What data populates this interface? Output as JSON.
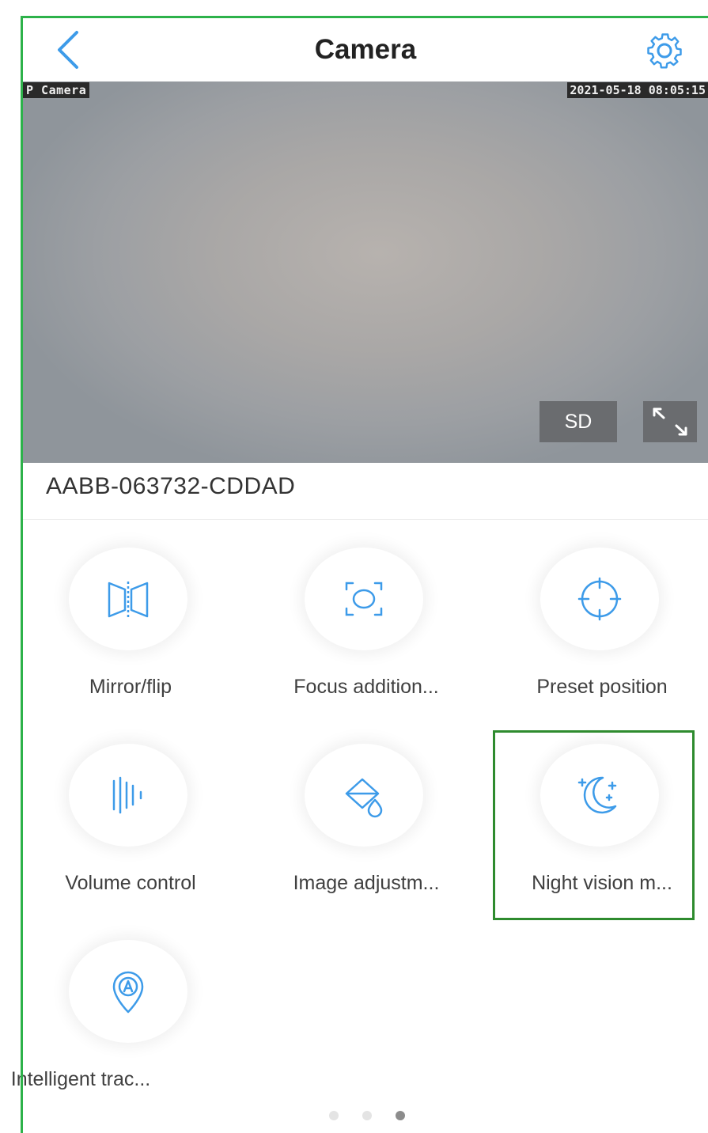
{
  "header": {
    "title": "Camera",
    "back_icon": "chevron-left-icon",
    "settings_icon": "gear-icon"
  },
  "video": {
    "camera_label": "P Camera",
    "timestamp": "2021-05-18 08:05:15",
    "quality_button": "SD",
    "fullscreen_icon": "expand-icon"
  },
  "device": {
    "id": "AABB-063732-CDDAD"
  },
  "functions": [
    {
      "label": "Mirror/flip",
      "icon": "mirror-flip-icon"
    },
    {
      "label": "Focus addition...",
      "icon": "focus-icon"
    },
    {
      "label": "Preset position",
      "icon": "crosshair-icon"
    },
    {
      "label": "Volume control",
      "icon": "sound-wave-icon"
    },
    {
      "label": "Image adjustm...",
      "icon": "color-fill-icon"
    },
    {
      "label": "Night vision m...",
      "icon": "moon-stars-icon"
    },
    {
      "label": "Intelligent trac...",
      "icon": "location-pin-icon"
    }
  ],
  "pager": {
    "pages": 3,
    "active_page": 3
  },
  "colors": {
    "accent": "#3d9be9",
    "highlight_border": "#2e8b2e",
    "frame_border": "#2db24a",
    "dot_active": "#8c8c8c",
    "dot_inactive": "#e4e4e4"
  }
}
